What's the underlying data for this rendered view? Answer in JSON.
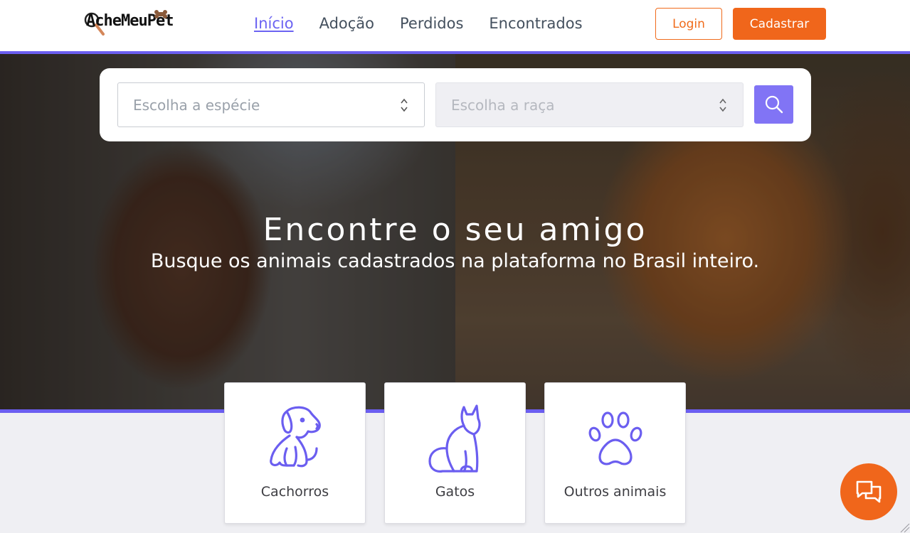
{
  "header": {
    "logo_text": "AcheMeuPet",
    "nav": [
      {
        "label": "Início",
        "active": true
      },
      {
        "label": "Adoção",
        "active": false
      },
      {
        "label": "Perdidos",
        "active": false
      },
      {
        "label": "Encontrados",
        "active": false
      }
    ],
    "login_label": "Login",
    "signup_label": "Cadastrar"
  },
  "search": {
    "species_placeholder": "Escolha a espécie",
    "breed_placeholder": "Escolha a raça",
    "search_icon": "search-icon"
  },
  "hero": {
    "title": "Encontre o seu amigo",
    "subtitle": "Busque os animais cadastrados na plataforma no Brasil inteiro."
  },
  "categories": [
    {
      "label": "Cachorros",
      "icon": "dog-icon"
    },
    {
      "label": "Gatos",
      "icon": "cat-icon"
    },
    {
      "label": "Outros animais",
      "icon": "paw-icon"
    }
  ],
  "chat": {
    "icon": "chat-icon"
  },
  "colors": {
    "accent": "#6b5ef0",
    "brand_orange": "#f0661b",
    "search_button": "#8174f5",
    "background": "#efeff3"
  }
}
